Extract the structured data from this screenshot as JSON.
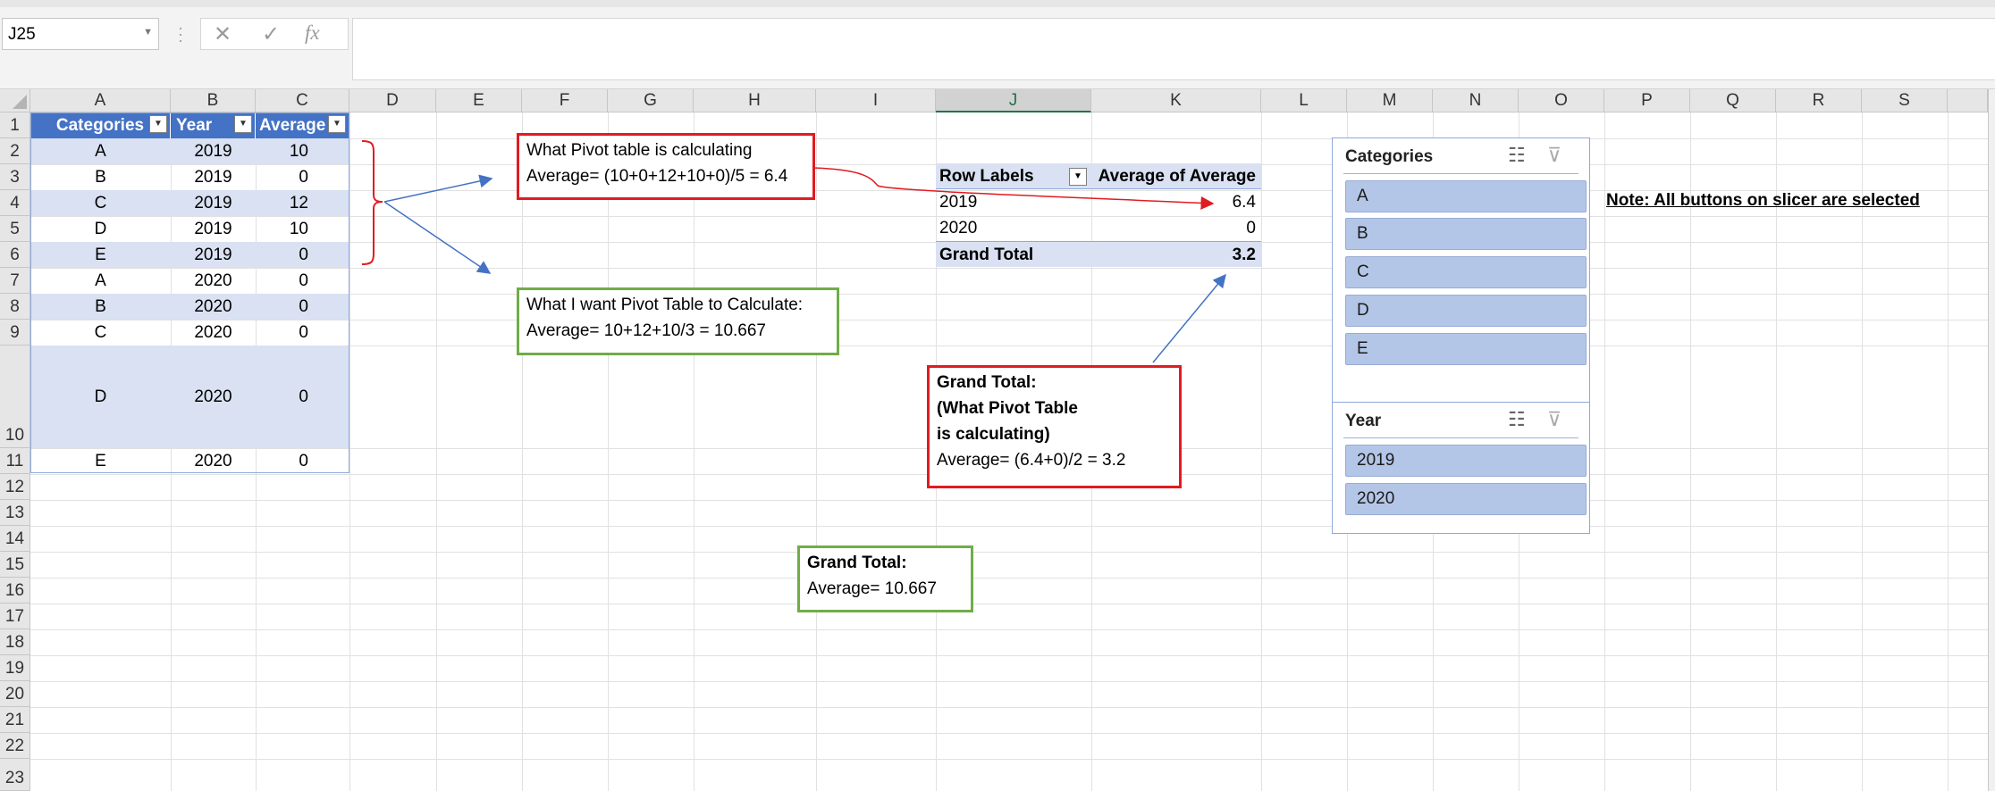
{
  "formula_bar": {
    "name_box": "J25",
    "cancel_icon": "✕",
    "enter_icon": "✓",
    "fx_label": "fx",
    "formula": ""
  },
  "columns": [
    "A",
    "B",
    "C",
    "D",
    "E",
    "F",
    "G",
    "H",
    "I",
    "J",
    "K",
    "L",
    "M",
    "N",
    "O",
    "P",
    "Q",
    "R",
    "S"
  ],
  "selected_column": "J",
  "rows": [
    "1",
    "2",
    "3",
    "4",
    "5",
    "6",
    "7",
    "8",
    "9",
    "10",
    "11",
    "12",
    "13",
    "14",
    "15",
    "16",
    "17",
    "18",
    "19",
    "20",
    "21",
    "22",
    "23"
  ],
  "table": {
    "headers": [
      "Categories",
      "Year",
      "Average"
    ],
    "rows": [
      [
        "A",
        "2019",
        "10"
      ],
      [
        "B",
        "2019",
        "0"
      ],
      [
        "C",
        "2019",
        "12"
      ],
      [
        "D",
        "2019",
        "10"
      ],
      [
        "E",
        "2019",
        "0"
      ],
      [
        "A",
        "2020",
        "0"
      ],
      [
        "B",
        "2020",
        "0"
      ],
      [
        "C",
        "2020",
        "0"
      ],
      [
        "D",
        "2020",
        "0"
      ],
      [
        "E",
        "2020",
        "0"
      ]
    ]
  },
  "annotations": {
    "pivot_calc": {
      "line1": "What Pivot table is calculating",
      "line2": "Average= (10+0+12+10+0)/5 = 6.4"
    },
    "want_calc": {
      "line1": "What I want Pivot Table to Calculate:",
      "line2": "Average= 10+12+10/3 = 10.667"
    },
    "grand_total_pivot": {
      "line1": "Grand Total:",
      "line2": "(What Pivot Table",
      "line3": "is calculating)",
      "line4": "Average= (6.4+0)/2 = 3.2"
    },
    "grand_total_want": {
      "line1": "Grand Total:",
      "line2": "Average= 10.667"
    },
    "note": "Note: All buttons on slicer are selected"
  },
  "pivot": {
    "row_labels_header": "Row Labels",
    "values_header": "Average of Average",
    "rows": [
      {
        "label": "2019",
        "value": "6.4"
      },
      {
        "label": "2020",
        "value": "0"
      }
    ],
    "total_label": "Grand Total",
    "total_value": "3.2"
  },
  "slicers": {
    "categories": {
      "title": "Categories",
      "items": [
        "A",
        "B",
        "C",
        "D",
        "E"
      ]
    },
    "year": {
      "title": "Year",
      "items": [
        "2019",
        "2020"
      ]
    }
  },
  "colors": {
    "table_header": "#4472c4",
    "table_band": "#d9e1f2",
    "slicer_button": "#b4c6e7",
    "red_box": "#e11b22",
    "green_box": "#70ad47",
    "arrow_blue": "#4472c4"
  }
}
